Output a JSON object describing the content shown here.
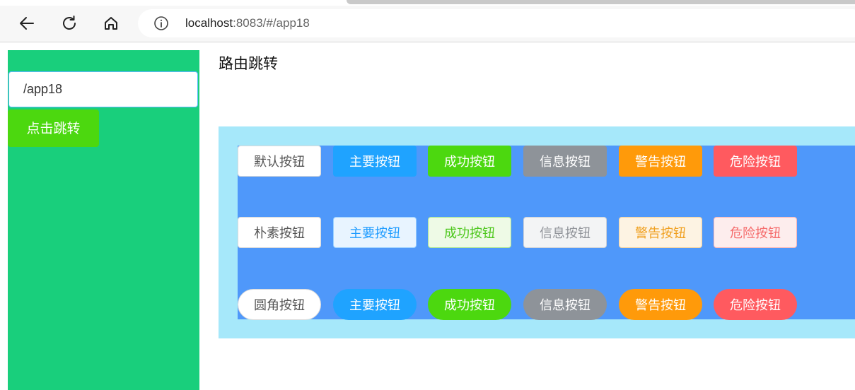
{
  "browser": {
    "url_host": "localhost",
    "url_rest": ":8083/#/app18",
    "icons": [
      "back-arrow-icon",
      "reload-icon",
      "home-icon",
      "info-icon"
    ]
  },
  "sidebar": {
    "route_value": "/app18",
    "jump_label": "点击跳转",
    "color": "#19cf7c"
  },
  "main": {
    "title": "路由跳转",
    "rows": [
      {
        "style": "normal",
        "labels": [
          "默认按钮",
          "主要按钮",
          "成功按钮",
          "信息按钮",
          "警告按钮",
          "危险按钮"
        ]
      },
      {
        "style": "plain",
        "labels": [
          "朴素按钮",
          "主要按钮",
          "成功按钮",
          "信息按钮",
          "警告按钮",
          "危险按钮"
        ]
      },
      {
        "style": "round",
        "labels": [
          "圆角按钮",
          "主要按钮",
          "成功按钮",
          "信息按钮",
          "警告按钮",
          "危险按钮"
        ]
      }
    ],
    "colors": {
      "panel": "#a6e8fa",
      "inner": "#4f98fa",
      "primary": "#1fa3ff",
      "success": "#4cd80f",
      "info": "#8e9399",
      "warning": "#ff9a0a",
      "danger": "#ff5a5f"
    }
  }
}
